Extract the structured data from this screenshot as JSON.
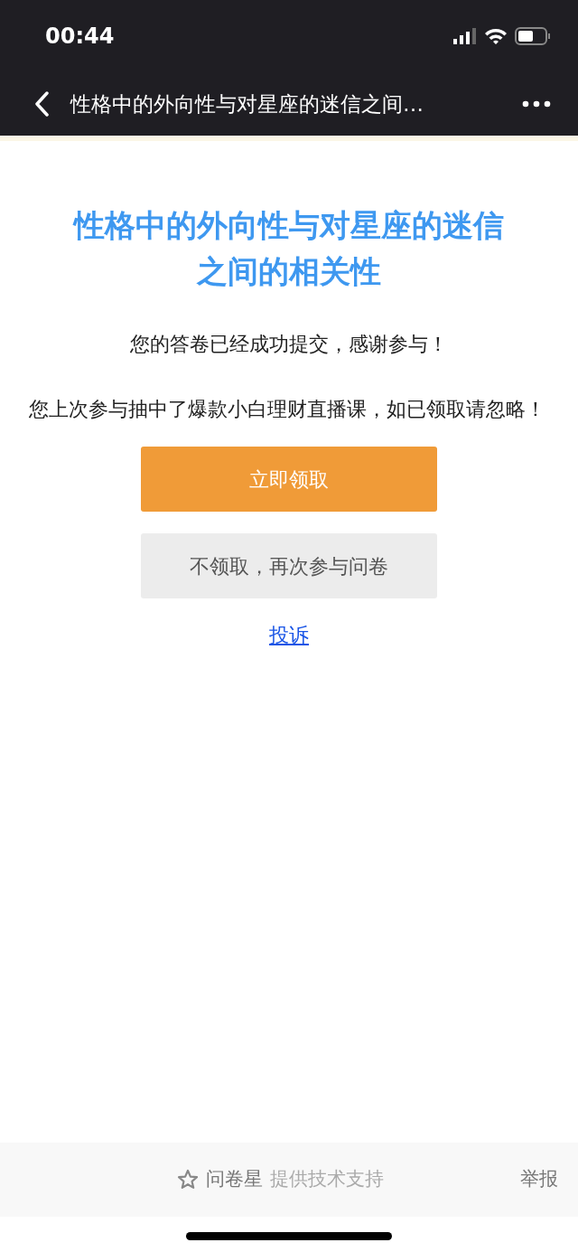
{
  "status_bar": {
    "time": "00:44"
  },
  "nav": {
    "title": "性格中的外向性与对星座的迷信之间…"
  },
  "survey": {
    "title": "性格中的外向性与对星座的迷信之间的相关性",
    "message": "您的答卷已经成功提交，感谢参与！",
    "notice": "您上次参与抽中了爆款小白理财直播课，如已领取请忽略！"
  },
  "buttons": [
    {
      "label": "立即领取",
      "kind": "primary"
    },
    {
      "label": "不领取，再次参与问卷",
      "kind": "secondary"
    }
  ],
  "complaint_link": "投诉",
  "footer": {
    "brand": "问卷星",
    "tagline": "提供技术支持",
    "report": "举报"
  }
}
